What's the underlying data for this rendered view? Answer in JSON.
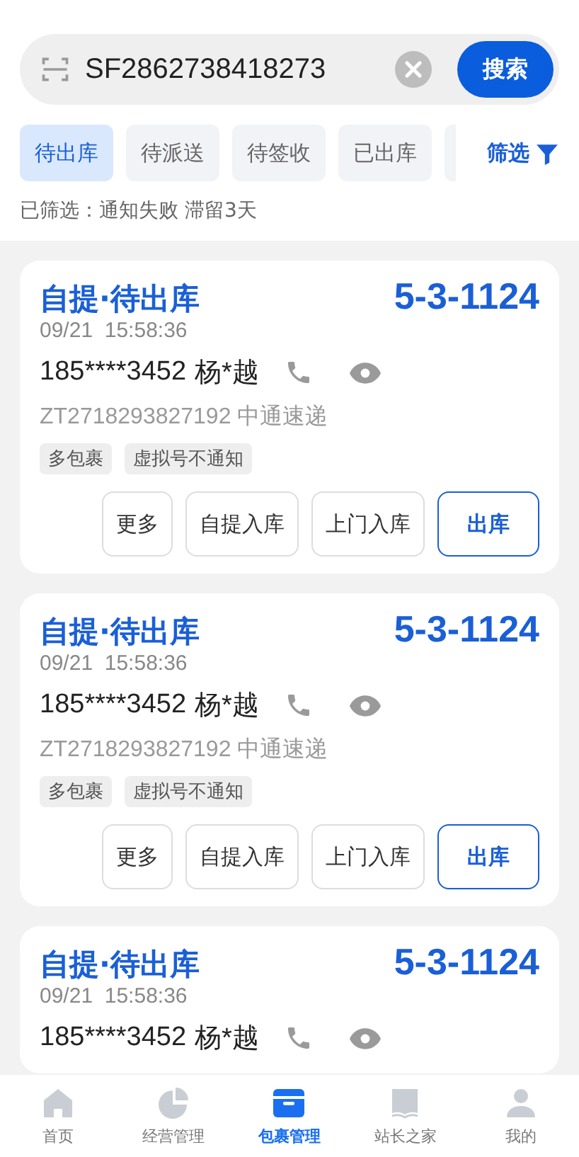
{
  "search": {
    "value": "SF2862738418273",
    "button": "搜索"
  },
  "status_tabs": [
    {
      "label": "待出库",
      "selected": true
    },
    {
      "label": "待派送",
      "selected": false
    },
    {
      "label": "待签收",
      "selected": false
    },
    {
      "label": "已出库",
      "selected": false
    }
  ],
  "filter_button": "筛选",
  "filter_summary": "已筛选：通知失败 滞留3天",
  "parcels": [
    {
      "title": "自提·待出库",
      "shelf_code": "5-3-1124",
      "time": "09/21  15:58:36",
      "phone": "185****3452",
      "name": "杨*越",
      "tracking": "ZT2718293827192 中通速递",
      "tags": [
        "多包裹",
        "虚拟号不通知"
      ],
      "actions": [
        {
          "label": "更多",
          "primary": false
        },
        {
          "label": "自提入库",
          "primary": false
        },
        {
          "label": "上门入库",
          "primary": false
        },
        {
          "label": "出库",
          "primary": true
        }
      ]
    },
    {
      "title": "自提·待出库",
      "shelf_code": "5-3-1124",
      "time": "09/21  15:58:36",
      "phone": "185****3452",
      "name": "杨*越",
      "tracking": "ZT2718293827192 中通速递",
      "tags": [
        "多包裹",
        "虚拟号不通知"
      ],
      "actions": [
        {
          "label": "更多",
          "primary": false
        },
        {
          "label": "自提入库",
          "primary": false
        },
        {
          "label": "上门入库",
          "primary": false
        },
        {
          "label": "出库",
          "primary": true
        }
      ]
    },
    {
      "title": "自提·待出库",
      "shelf_code": "5-3-1124",
      "time": "09/21  15:58:36",
      "phone": "185****3452",
      "name": "杨*越"
    }
  ],
  "tab_bar": [
    {
      "label": "首页",
      "kind": "home",
      "selected": false
    },
    {
      "label": "经营管理",
      "kind": "chart",
      "selected": false
    },
    {
      "label": "包裹管理",
      "kind": "box",
      "selected": true
    },
    {
      "label": "站长之家",
      "kind": "book",
      "selected": false
    },
    {
      "label": "我的",
      "kind": "person",
      "selected": false
    }
  ]
}
